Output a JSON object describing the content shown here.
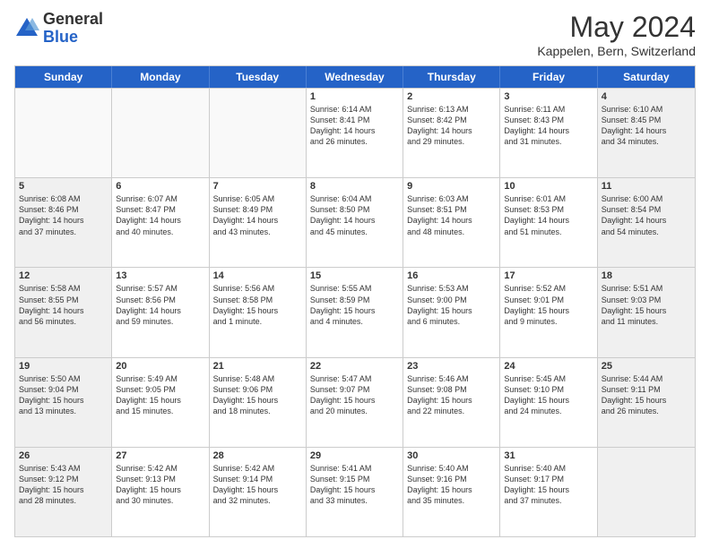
{
  "header": {
    "logo_general": "General",
    "logo_blue": "Blue",
    "month_title": "May 2024",
    "location": "Kappelen, Bern, Switzerland"
  },
  "calendar": {
    "days_of_week": [
      "Sunday",
      "Monday",
      "Tuesday",
      "Wednesday",
      "Thursday",
      "Friday",
      "Saturday"
    ],
    "rows": [
      [
        {
          "day": "",
          "info": "",
          "empty": true
        },
        {
          "day": "",
          "info": "",
          "empty": true
        },
        {
          "day": "",
          "info": "",
          "empty": true
        },
        {
          "day": "1",
          "info": "Sunrise: 6:14 AM\nSunset: 8:41 PM\nDaylight: 14 hours\nand 26 minutes.",
          "empty": false
        },
        {
          "day": "2",
          "info": "Sunrise: 6:13 AM\nSunset: 8:42 PM\nDaylight: 14 hours\nand 29 minutes.",
          "empty": false
        },
        {
          "day": "3",
          "info": "Sunrise: 6:11 AM\nSunset: 8:43 PM\nDaylight: 14 hours\nand 31 minutes.",
          "empty": false
        },
        {
          "day": "4",
          "info": "Sunrise: 6:10 AM\nSunset: 8:45 PM\nDaylight: 14 hours\nand 34 minutes.",
          "empty": false,
          "shaded": true
        }
      ],
      [
        {
          "day": "5",
          "info": "Sunrise: 6:08 AM\nSunset: 8:46 PM\nDaylight: 14 hours\nand 37 minutes.",
          "empty": false,
          "shaded": true
        },
        {
          "day": "6",
          "info": "Sunrise: 6:07 AM\nSunset: 8:47 PM\nDaylight: 14 hours\nand 40 minutes.",
          "empty": false
        },
        {
          "day": "7",
          "info": "Sunrise: 6:05 AM\nSunset: 8:49 PM\nDaylight: 14 hours\nand 43 minutes.",
          "empty": false
        },
        {
          "day": "8",
          "info": "Sunrise: 6:04 AM\nSunset: 8:50 PM\nDaylight: 14 hours\nand 45 minutes.",
          "empty": false
        },
        {
          "day": "9",
          "info": "Sunrise: 6:03 AM\nSunset: 8:51 PM\nDaylight: 14 hours\nand 48 minutes.",
          "empty": false
        },
        {
          "day": "10",
          "info": "Sunrise: 6:01 AM\nSunset: 8:53 PM\nDaylight: 14 hours\nand 51 minutes.",
          "empty": false
        },
        {
          "day": "11",
          "info": "Sunrise: 6:00 AM\nSunset: 8:54 PM\nDaylight: 14 hours\nand 54 minutes.",
          "empty": false,
          "shaded": true
        }
      ],
      [
        {
          "day": "12",
          "info": "Sunrise: 5:58 AM\nSunset: 8:55 PM\nDaylight: 14 hours\nand 56 minutes.",
          "empty": false,
          "shaded": true
        },
        {
          "day": "13",
          "info": "Sunrise: 5:57 AM\nSunset: 8:56 PM\nDaylight: 14 hours\nand 59 minutes.",
          "empty": false
        },
        {
          "day": "14",
          "info": "Sunrise: 5:56 AM\nSunset: 8:58 PM\nDaylight: 15 hours\nand 1 minute.",
          "empty": false
        },
        {
          "day": "15",
          "info": "Sunrise: 5:55 AM\nSunset: 8:59 PM\nDaylight: 15 hours\nand 4 minutes.",
          "empty": false
        },
        {
          "day": "16",
          "info": "Sunrise: 5:53 AM\nSunset: 9:00 PM\nDaylight: 15 hours\nand 6 minutes.",
          "empty": false
        },
        {
          "day": "17",
          "info": "Sunrise: 5:52 AM\nSunset: 9:01 PM\nDaylight: 15 hours\nand 9 minutes.",
          "empty": false
        },
        {
          "day": "18",
          "info": "Sunrise: 5:51 AM\nSunset: 9:03 PM\nDaylight: 15 hours\nand 11 minutes.",
          "empty": false,
          "shaded": true
        }
      ],
      [
        {
          "day": "19",
          "info": "Sunrise: 5:50 AM\nSunset: 9:04 PM\nDaylight: 15 hours\nand 13 minutes.",
          "empty": false,
          "shaded": true
        },
        {
          "day": "20",
          "info": "Sunrise: 5:49 AM\nSunset: 9:05 PM\nDaylight: 15 hours\nand 15 minutes.",
          "empty": false
        },
        {
          "day": "21",
          "info": "Sunrise: 5:48 AM\nSunset: 9:06 PM\nDaylight: 15 hours\nand 18 minutes.",
          "empty": false
        },
        {
          "day": "22",
          "info": "Sunrise: 5:47 AM\nSunset: 9:07 PM\nDaylight: 15 hours\nand 20 minutes.",
          "empty": false
        },
        {
          "day": "23",
          "info": "Sunrise: 5:46 AM\nSunset: 9:08 PM\nDaylight: 15 hours\nand 22 minutes.",
          "empty": false
        },
        {
          "day": "24",
          "info": "Sunrise: 5:45 AM\nSunset: 9:10 PM\nDaylight: 15 hours\nand 24 minutes.",
          "empty": false
        },
        {
          "day": "25",
          "info": "Sunrise: 5:44 AM\nSunset: 9:11 PM\nDaylight: 15 hours\nand 26 minutes.",
          "empty": false,
          "shaded": true
        }
      ],
      [
        {
          "day": "26",
          "info": "Sunrise: 5:43 AM\nSunset: 9:12 PM\nDaylight: 15 hours\nand 28 minutes.",
          "empty": false,
          "shaded": true
        },
        {
          "day": "27",
          "info": "Sunrise: 5:42 AM\nSunset: 9:13 PM\nDaylight: 15 hours\nand 30 minutes.",
          "empty": false
        },
        {
          "day": "28",
          "info": "Sunrise: 5:42 AM\nSunset: 9:14 PM\nDaylight: 15 hours\nand 32 minutes.",
          "empty": false
        },
        {
          "day": "29",
          "info": "Sunrise: 5:41 AM\nSunset: 9:15 PM\nDaylight: 15 hours\nand 33 minutes.",
          "empty": false
        },
        {
          "day": "30",
          "info": "Sunrise: 5:40 AM\nSunset: 9:16 PM\nDaylight: 15 hours\nand 35 minutes.",
          "empty": false
        },
        {
          "day": "31",
          "info": "Sunrise: 5:40 AM\nSunset: 9:17 PM\nDaylight: 15 hours\nand 37 minutes.",
          "empty": false
        },
        {
          "day": "",
          "info": "",
          "empty": true,
          "shaded": true
        }
      ]
    ]
  }
}
